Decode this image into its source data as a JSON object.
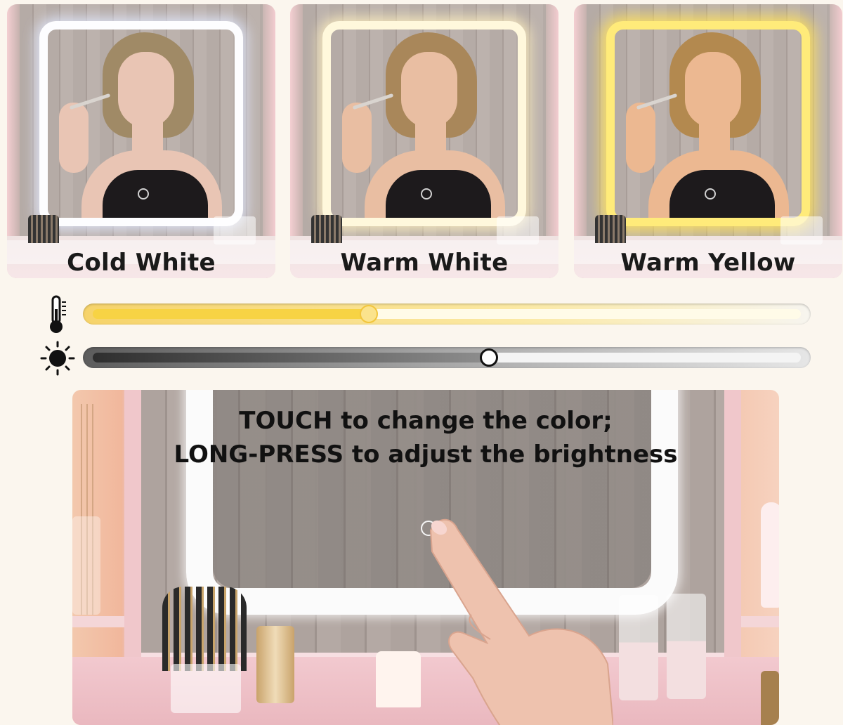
{
  "panels": [
    {
      "id": "cold",
      "label": "Cold White",
      "light_color": "#fdfdff"
    },
    {
      "id": "warmwhite",
      "label": "Warm White",
      "light_color": "#fff8dc"
    },
    {
      "id": "warmyellow",
      "label": "Warm Yellow",
      "light_color": "#ffeb7a"
    }
  ],
  "sliders": {
    "color_temperature": {
      "icon": "thermometer-icon",
      "value": 0.39,
      "accent": "#f7d344"
    },
    "brightness": {
      "icon": "sun-icon",
      "value": 0.56,
      "accent": "#2e2e2e"
    }
  },
  "caption": {
    "line1": "TOUCH to change the color;",
    "line2": "LONG-PRESS to adjust the brightness"
  },
  "colors": {
    "background": "#fbf6ee",
    "vanity_pink": "#f0c7cb"
  }
}
